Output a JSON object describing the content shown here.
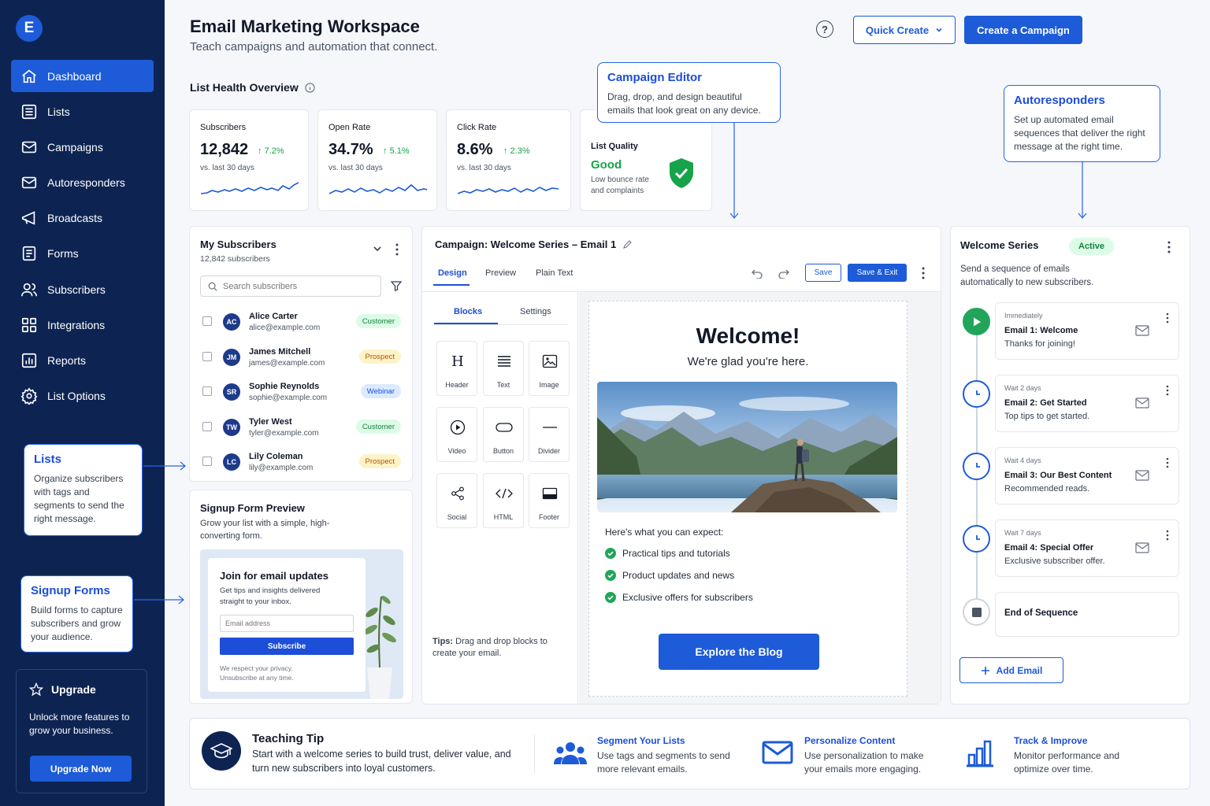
{
  "app": {
    "logo_letter": "E",
    "title": "Email Marketing Workspace",
    "subtitle": "Teach campaigns and automation that connect."
  },
  "sidebar": {
    "items": [
      {
        "label": "Dashboard",
        "icon": "home-icon",
        "active": true
      },
      {
        "label": "Lists",
        "icon": "list-icon"
      },
      {
        "label": "Campaigns",
        "icon": "mail-icon"
      },
      {
        "label": "Autoresponders",
        "icon": "mail-icon"
      },
      {
        "label": "Broadcasts",
        "icon": "megaphone-icon"
      },
      {
        "label": "Forms",
        "icon": "form-icon"
      },
      {
        "label": "Subscribers",
        "icon": "users-icon"
      },
      {
        "label": "Integrations",
        "icon": "grid-icon"
      },
      {
        "label": "Reports",
        "icon": "bar-chart-icon"
      },
      {
        "label": "List Options",
        "icon": "gear-icon"
      }
    ],
    "lists_callout": {
      "title": "Lists",
      "desc": "Organize subscribers with tags and segments to send the right message."
    },
    "forms_callout": {
      "title": "Signup Forms",
      "desc": "Build forms to capture subscribers and grow your audience."
    },
    "upgrade": {
      "title": "Upgrade",
      "desc": "Unlock more features to grow your business.",
      "button": "Upgrade Now"
    }
  },
  "header": {
    "quick_create": "Quick Create",
    "create_campaign": "Create a Campaign",
    "help": "?"
  },
  "list_health": {
    "title": "List Health Overview",
    "stats": [
      {
        "label": "Subscribers",
        "value": "12,842",
        "change": "7.2%",
        "period": "vs. last 30 days"
      },
      {
        "label": "Open Rate",
        "value": "34.7%",
        "change": "5.1%",
        "period": "vs. last 30 days"
      },
      {
        "label": "Click Rate",
        "value": "8.6%",
        "change": "2.3%",
        "period": "vs. last 30 days"
      }
    ],
    "quality": {
      "label": "List Quality",
      "value": "Good",
      "desc": "Low bounce rate and complaints"
    }
  },
  "callouts": {
    "editor": {
      "title": "Campaign Editor",
      "desc": "Drag, drop, and design beautiful emails that look great on any device."
    },
    "autoresponders": {
      "title": "Autoresponders",
      "desc": "Set up automated email sequences that deliver the right message at the right time."
    }
  },
  "subscribers": {
    "title": "My Subscribers",
    "count": "12,842 subscribers",
    "search_placeholder": "Search subscribers",
    "rows": [
      {
        "initials": "AC",
        "name": "Alice Carter",
        "email": "alice@example.com",
        "tag": "Customer",
        "tag_type": "customer"
      },
      {
        "initials": "JM",
        "name": "James Mitchell",
        "email": "james@example.com",
        "tag": "Prospect",
        "tag_type": "prospect"
      },
      {
        "initials": "SR",
        "name": "Sophie Reynolds",
        "email": "sophie@example.com",
        "tag": "Webinar",
        "tag_type": "webinar"
      },
      {
        "initials": "TW",
        "name": "Tyler West",
        "email": "tyler@example.com",
        "tag": "Customer",
        "tag_type": "customer"
      },
      {
        "initials": "LC",
        "name": "Lily Coleman",
        "email": "lily@example.com",
        "tag": "Prospect",
        "tag_type": "prospect"
      }
    ]
  },
  "signup_form": {
    "title": "Signup Form Preview",
    "desc": "Grow your list with a simple, high-converting form.",
    "form_title": "Join for email updates",
    "form_desc": "Get tips and insights delivered straight to your inbox.",
    "email_placeholder": "Email address",
    "button": "Subscribe",
    "privacy": "We respect your privacy. Unsubscribe at any time."
  },
  "editor": {
    "title": "Campaign: Welcome Series – Email 1",
    "tabs": [
      "Design",
      "Preview",
      "Plain Text"
    ],
    "save": "Save",
    "save_exit": "Save & Exit",
    "panel_tabs": [
      "Blocks",
      "Settings"
    ],
    "blocks": [
      {
        "label": "Header",
        "icon": "header-icon"
      },
      {
        "label": "Text",
        "icon": "text-icon"
      },
      {
        "label": "Image",
        "icon": "image-icon"
      },
      {
        "label": "Video",
        "icon": "video-icon"
      },
      {
        "label": "Button",
        "icon": "button-icon"
      },
      {
        "label": "Divider",
        "icon": "divider-icon"
      },
      {
        "label": "Social",
        "icon": "share-icon"
      },
      {
        "label": "HTML",
        "icon": "code-icon"
      },
      {
        "label": "Footer",
        "icon": "footer-icon"
      }
    ],
    "tips_label": "Tips:",
    "tips": "Drag and drop blocks to create your email.",
    "email": {
      "heading": "Welcome!",
      "subheading": "We're glad you're here.",
      "intro": "Here's what you can expect:",
      "bullets": [
        "Practical tips and tutorials",
        "Product updates and news",
        "Exclusive offers for subscribers"
      ],
      "cta": "Explore the Blog"
    }
  },
  "sequence": {
    "title": "Welcome Series",
    "status": "Active",
    "desc": "Send a sequence of emails automatically to new subscribers.",
    "emails": [
      {
        "wait": "Immediately",
        "title": "Email 1: Welcome",
        "desc": "Thanks for joining!"
      },
      {
        "wait": "Wait 2 days",
        "title": "Email 2: Get Started",
        "desc": "Top tips to get started."
      },
      {
        "wait": "Wait 4 days",
        "title": "Email 3: Our Best Content",
        "desc": "Recommended reads."
      },
      {
        "wait": "Wait 7 days",
        "title": "Email 4: Special Offer",
        "desc": "Exclusive subscriber offer."
      }
    ],
    "end": "End of Sequence",
    "add": "Add Email"
  },
  "teaching": {
    "title": "Teaching Tip",
    "desc": "Start with a welcome series to build trust, deliver value, and turn new subscribers into loyal customers.",
    "features": [
      {
        "title": "Segment Your Lists",
        "desc": "Use tags and segments to send more relevant emails."
      },
      {
        "title": "Personalize Content",
        "desc": "Use personalization to make your emails more engaging."
      },
      {
        "title": "Track & Improve",
        "desc": "Monitor performance and optimize over time."
      }
    ]
  },
  "colors": {
    "sidebar": "#0d2452",
    "accent": "#1d5bd8",
    "success": "#16a34a"
  }
}
